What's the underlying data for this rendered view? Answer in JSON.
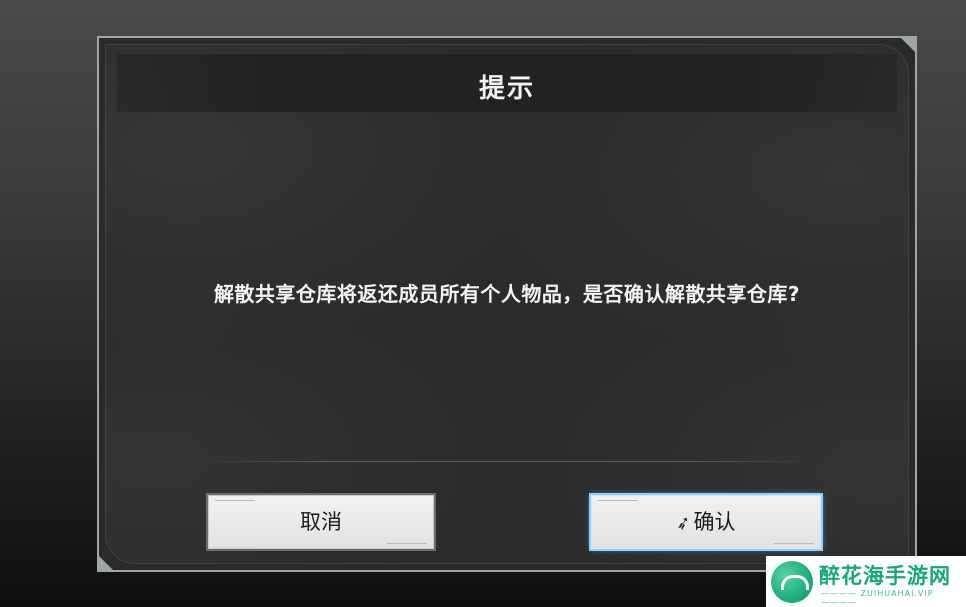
{
  "dialog": {
    "title": "提示",
    "message": "解散共享仓库将返还成员所有个人物品，是否确认解散共享仓库?",
    "cancel_label": "取消",
    "confirm_label": "确认"
  },
  "watermark": {
    "title": "醉花海手游网",
    "subtitle": "———— ZUIHUAHAI.VIP ————"
  },
  "colors": {
    "dialog_bg": "#2b2b2b",
    "text": "#f4f4f4",
    "button_bg": "#e8e8e8",
    "confirm_glow": "#8fd0ff",
    "watermark_green": "#17a77a"
  },
  "icons": {
    "cursor": "pointer-cursor-icon"
  }
}
